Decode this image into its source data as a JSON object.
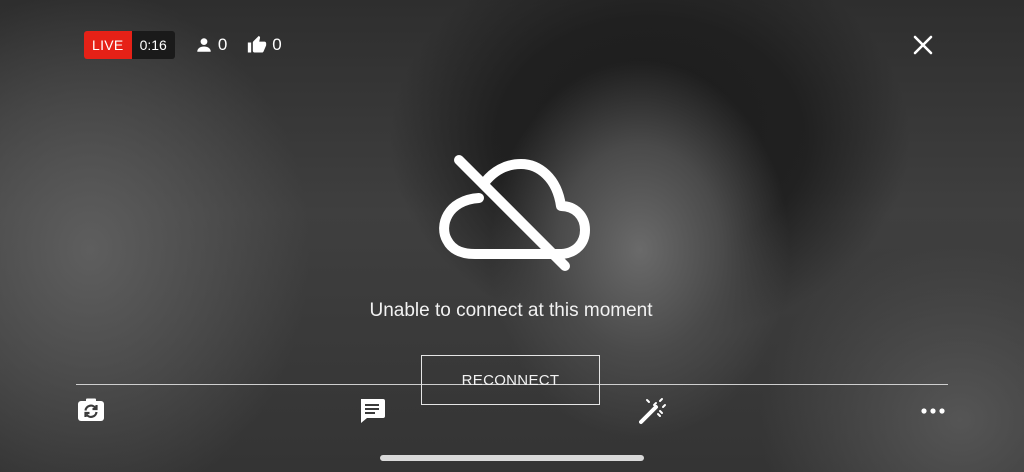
{
  "live": {
    "label": "LIVE",
    "time": "0:16"
  },
  "stats": {
    "viewers": "0",
    "likes": "0"
  },
  "status": {
    "message": "Unable to connect at this moment",
    "reconnect_label": "RECONNECT"
  },
  "icons": {
    "viewers": "person-icon",
    "likes": "thumbs-up-icon",
    "close": "close-icon",
    "offline": "cloud-off-icon",
    "flip_camera": "flip-camera-icon",
    "chat": "chat-icon",
    "effects": "magic-wand-icon",
    "more": "more-icon"
  },
  "colors": {
    "live_red": "#e62117"
  }
}
